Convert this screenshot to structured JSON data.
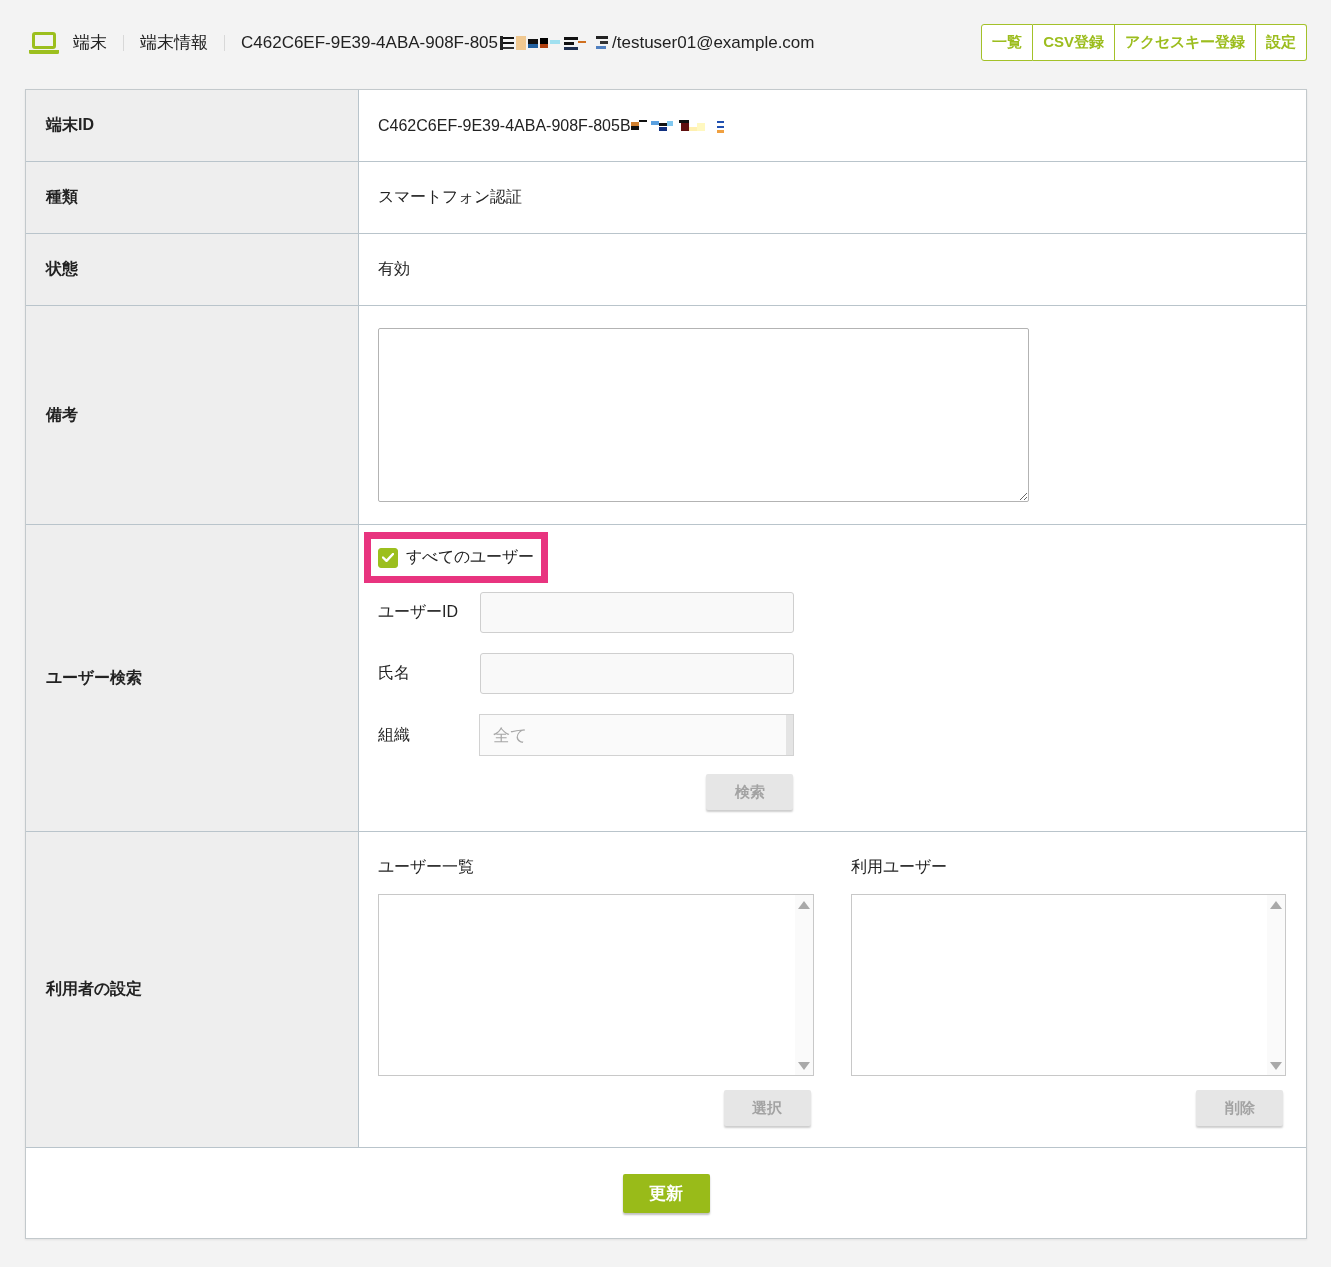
{
  "header": {
    "breadcrumbs": [
      "端末",
      "端末情報"
    ],
    "title_parts": [
      {
        "kind": "text",
        "text": "C462C6EF-9E39-4ABA-908F-805"
      },
      {
        "kind": "redacted"
      },
      {
        "kind": "text",
        "text": "/testuser01@example.com"
      }
    ]
  },
  "toolbar": {
    "buttons": [
      "一覧",
      "CSV登録",
      "アクセスキー登録",
      "設定"
    ]
  },
  "form": {
    "rows": [
      {
        "kind": "text",
        "label": "端末ID",
        "parts": [
          {
            "kind": "text",
            "text": "C462C6EF-9E39-4ABA-908F-805B"
          },
          {
            "kind": "redacted"
          }
        ]
      },
      {
        "kind": "text",
        "label": "種類",
        "parts": [
          {
            "kind": "text",
            "text": "スマートフォン認証"
          }
        ]
      },
      {
        "kind": "text",
        "label": "状態",
        "parts": [
          {
            "kind": "text",
            "text": "有効"
          }
        ]
      },
      {
        "kind": "textarea",
        "label": "備考"
      },
      {
        "kind": "user_search",
        "label": "ユーザー検索",
        "all_users": {
          "label": "すべてのユーザー",
          "checked": true,
          "highlighted": true
        },
        "fields": [
          {
            "kind": "input",
            "label": "ユーザーID"
          },
          {
            "kind": "input",
            "label": "氏名"
          },
          {
            "kind": "select",
            "label": "組織",
            "value": "全て",
            "disabled": true
          }
        ],
        "button": {
          "label": "検索",
          "disabled": true
        }
      },
      {
        "kind": "user_lists",
        "label": "利用者の設定",
        "lists": [
          {
            "title": "ユーザー一覧",
            "button": {
              "label": "選択",
              "disabled": true
            }
          },
          {
            "title": "利用ユーザー",
            "button": {
              "label": "削除",
              "disabled": true
            }
          }
        ]
      }
    ]
  },
  "submit": {
    "label": "更新",
    "disabled": false
  }
}
